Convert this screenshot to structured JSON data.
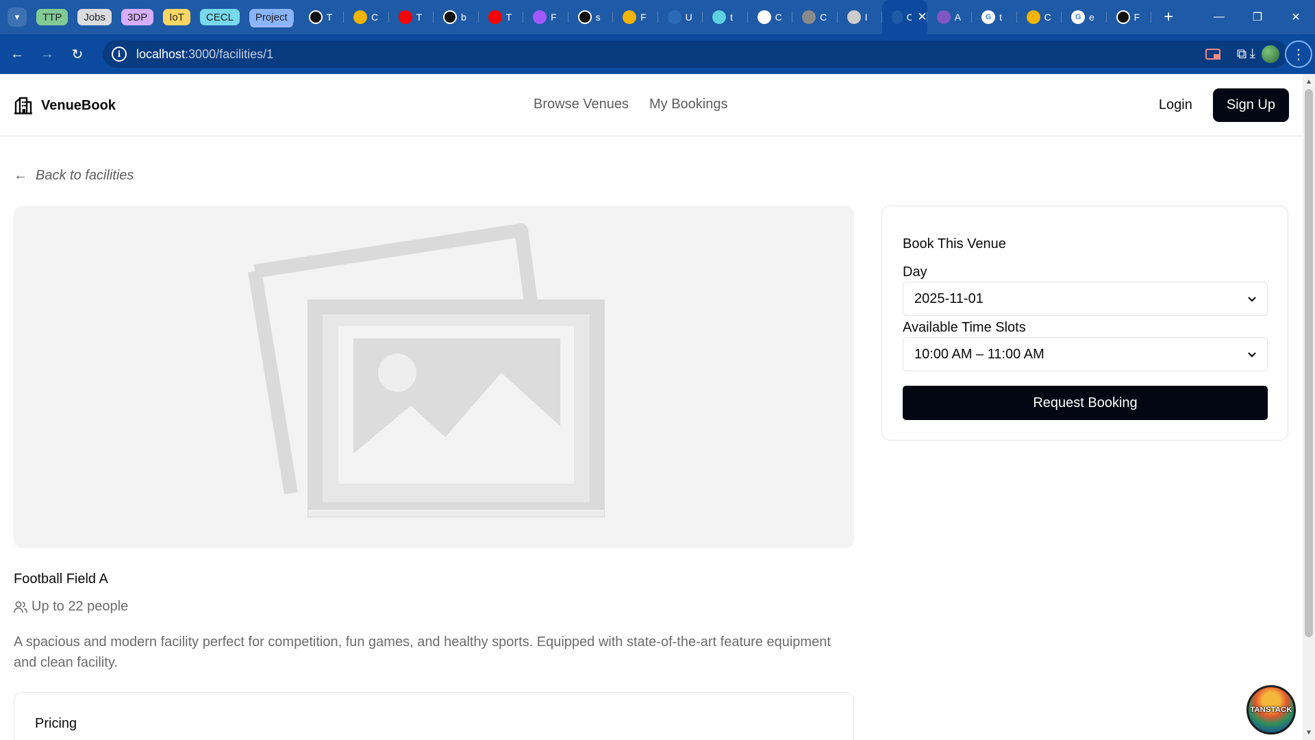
{
  "browser": {
    "tab_groups": [
      {
        "label": "TTP",
        "color": "#81c995"
      },
      {
        "label": "Jobs",
        "color": "#dadce0"
      },
      {
        "label": "3DP",
        "color": "#d7aefb"
      },
      {
        "label": "IoT",
        "color": "#fdd663"
      },
      {
        "label": "CECL",
        "color": "#78d9ec"
      },
      {
        "label": "Project",
        "color": "#8ab4f8"
      }
    ],
    "tabs": [
      {
        "title": "T",
        "icon": "github-icon",
        "color": "#111111"
      },
      {
        "title": "C",
        "icon": "chrome-icon",
        "color": "#f4b400"
      },
      {
        "title": "T",
        "icon": "youtube-icon",
        "color": "#ff0000"
      },
      {
        "title": "b",
        "icon": "github-icon",
        "color": "#111111"
      },
      {
        "title": "T",
        "icon": "youtube-icon",
        "color": "#ff0000"
      },
      {
        "title": "F",
        "icon": "figma-icon",
        "color": "#a259ff"
      },
      {
        "title": "s",
        "icon": "github-icon",
        "color": "#111111"
      },
      {
        "title": "F",
        "icon": "chrome-icon",
        "color": "#f4b400"
      },
      {
        "title": "U",
        "icon": "gorm-icon",
        "color": "#2a6bb7"
      },
      {
        "title": "t",
        "icon": "notebook-icon",
        "color": "#5fd0e0"
      },
      {
        "title": "C",
        "icon": "openai-icon",
        "color": "#ffffff"
      },
      {
        "title": "C",
        "icon": "globe-icon",
        "color": "#8a8a8a"
      },
      {
        "title": "I",
        "icon": "mountain-icon",
        "color": "#cccccc"
      },
      {
        "title": "C",
        "icon": "page-icon",
        "color": "#1f5aa6",
        "active": true
      },
      {
        "title": "A",
        "icon": "app-icon",
        "color": "#7e57c2"
      },
      {
        "title": "t",
        "icon": "google-icon",
        "color": "#ffffff"
      },
      {
        "title": "C",
        "icon": "chrome-icon",
        "color": "#f4b400"
      },
      {
        "title": "e",
        "icon": "google-icon",
        "color": "#ffffff"
      },
      {
        "title": "F",
        "icon": "github-icon",
        "color": "#111111"
      }
    ],
    "url_host": "localhost",
    "url_path": ":3000/facilities/1"
  },
  "site": {
    "brand": "VenueBook",
    "nav": [
      "Browse Venues",
      "My Bookings"
    ],
    "login": "Login",
    "signup": "Sign Up"
  },
  "page": {
    "back_label": "Back to facilities",
    "facility_name": "Football Field A",
    "capacity": "Up to 22 people",
    "description": "A spacious and modern facility perfect for competition, fun games, and healthy sports. Equipped with state-of-the-art feature equipment and clean facility.",
    "pricing_heading": "Pricing"
  },
  "booking": {
    "title": "Book This Venue",
    "day_label": "Day",
    "day_value": "2025-11-01",
    "slots_label": "Available Time Slots",
    "slot_value": "10:00 AM – 11:00 AM",
    "submit": "Request Booking"
  },
  "devtools": {
    "badge": "TANSTACK"
  },
  "colors": {
    "primary_button": "#030712",
    "muted_text": "#6b6b6b",
    "chrome_blue": "#1f5aa6"
  }
}
